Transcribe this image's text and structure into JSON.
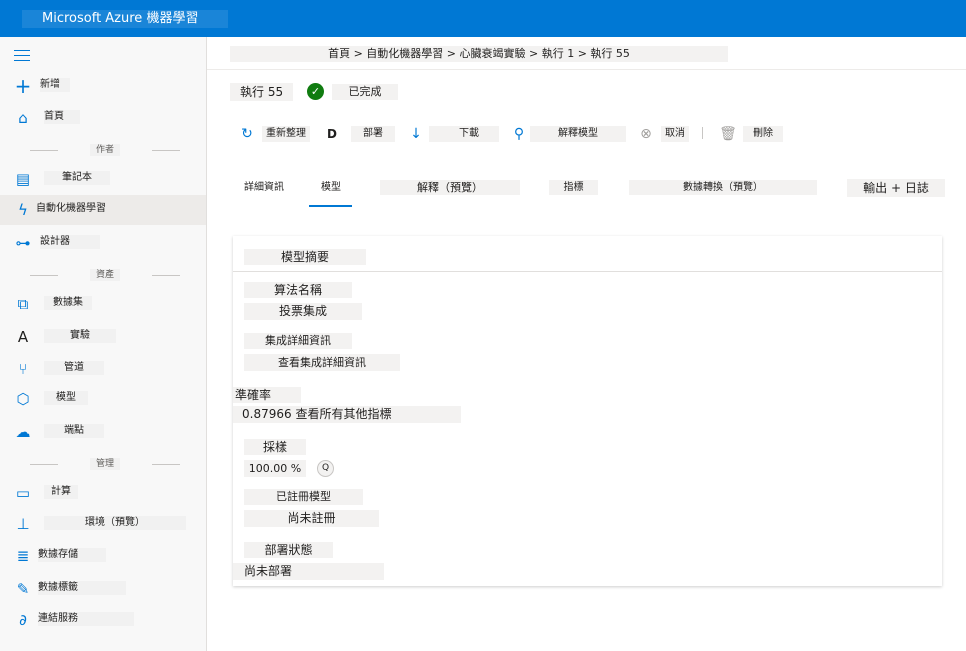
{
  "app": {
    "title": "Microsoft Azure 機器學習"
  },
  "sidebar": {
    "items": [
      {
        "label": "新增",
        "icon": "plus-icon"
      },
      {
        "label": "首頁",
        "icon": "home-icon"
      },
      {
        "section": "作者"
      },
      {
        "label": "筆記本",
        "icon": "notebook-icon"
      },
      {
        "label": "自動化機器學習",
        "icon": "automl-icon",
        "active": true
      },
      {
        "label": "設計器",
        "icon": "designer-icon"
      },
      {
        "section": "資產"
      },
      {
        "label": "數據集",
        "icon": "datasets-icon"
      },
      {
        "label": "實驗",
        "icon": "experiments-icon"
      },
      {
        "label": "管道",
        "icon": "pipelines-icon"
      },
      {
        "label": "模型",
        "icon": "models-icon"
      },
      {
        "label": "端點",
        "icon": "endpoints-icon"
      },
      {
        "section": "管理"
      },
      {
        "label": "計算",
        "icon": "compute-icon"
      },
      {
        "label": "環境（預覽）",
        "icon": "environments-icon"
      },
      {
        "label": "數據存儲",
        "icon": "datastores-icon"
      },
      {
        "label": "數據標籤",
        "icon": "data-labeling-icon"
      },
      {
        "label": "連結服務",
        "icon": "linked-services-icon"
      }
    ]
  },
  "breadcrumb": "首頁 > 自動化機器學習 > 心臟衰竭實驗 > 執行 1 > 執行 55",
  "run": {
    "title": "執行 55",
    "status": "已完成"
  },
  "toolbar": {
    "refresh": "重新整理",
    "deploy_icon_letter": "D",
    "deploy": "部署",
    "download": "下載",
    "explain": "解釋模型",
    "cancel": "取消",
    "delete": "刪除"
  },
  "tabs": [
    {
      "label": "詳細資訊"
    },
    {
      "label": "模型",
      "active": true
    },
    {
      "label": "解釋（預覽）"
    },
    {
      "label": "指標"
    },
    {
      "label": "數據轉換（預覽）"
    },
    {
      "label": "輸出 + 日誌"
    }
  ],
  "model_summary": {
    "title": "模型摘要",
    "algorithm_label": "算法名稱",
    "algorithm_value": "投票集成",
    "ensemble_label": "集成詳細資訊",
    "ensemble_link": "查看集成詳細資訊",
    "accuracy_label": "準確率",
    "accuracy_value": "0.87966 查看所有其他指標",
    "sampling_label": "採樣",
    "sampling_value": "100.00 %",
    "sampling_info_icon": "Q",
    "registered_label": "已註冊模型",
    "registered_value": "尚未註冊",
    "deploy_status_label": "部署狀態",
    "deploy_status_value": "尚未部署"
  },
  "colors": {
    "accent": "#0078d4",
    "success": "#107c10"
  }
}
